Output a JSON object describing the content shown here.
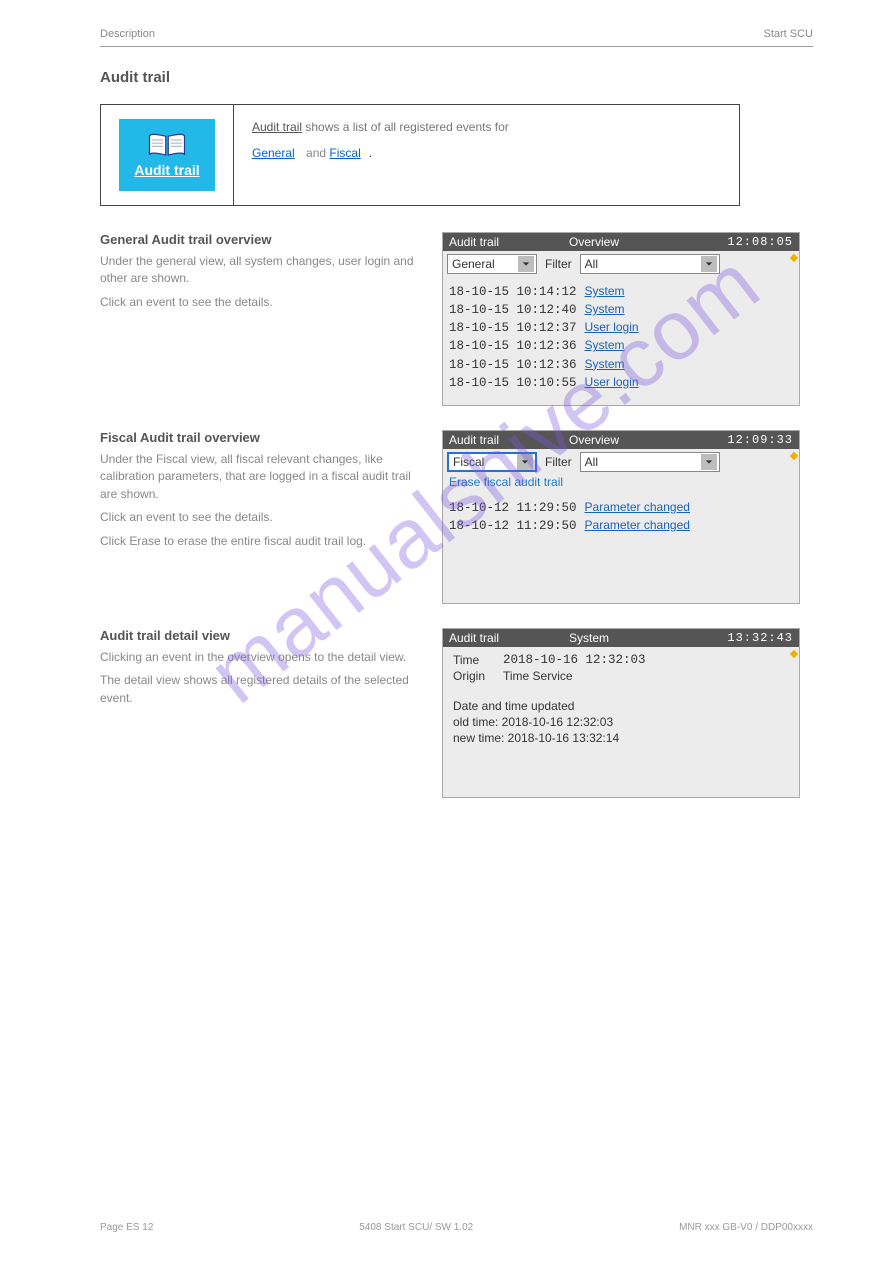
{
  "header": {
    "left": "Description",
    "right": "Start SCU"
  },
  "watermark": "manualshive.com",
  "section_title": "Audit trail",
  "icon_box": {
    "label": "Audit trail"
  },
  "desc": {
    "lead": "Audit trail",
    "text": " shows a list of all registered events for",
    "link1": "General",
    "and": "and",
    "link2": "Fiscal",
    "tail": "."
  },
  "rows": [
    {
      "id": "general",
      "heading": "General Audit trail overview",
      "paras": [
        "Under the general view, all system changes, user login and other are shown.",
        "Click an event to see the details."
      ],
      "panel": {
        "title_left": "Audit trail",
        "title_mid": "Overview",
        "title_right": "12:08:05",
        "select_value": "General",
        "filter_label": "Filter",
        "filter_value": "All",
        "logs": [
          {
            "dt": "18-10-15 10:14:12",
            "evt": "System"
          },
          {
            "dt": "18-10-15 10:12:40",
            "evt": "System"
          },
          {
            "dt": "18-10-15 10:12:37",
            "evt": "User login"
          },
          {
            "dt": "18-10-15 10:12:36",
            "evt": "System"
          },
          {
            "dt": "18-10-15 10:12:36",
            "evt": "System"
          },
          {
            "dt": "18-10-15 10:10:55",
            "evt": "User login"
          }
        ]
      }
    },
    {
      "id": "fiscal",
      "heading": "Fiscal Audit trail overview",
      "paras": [
        "Under the Fiscal view, all fiscal relevant changes, like calibration parameters, that are logged in a fiscal audit trail are shown.",
        "Click an event to see the details.",
        "Click Erase to erase the entire fiscal audit trail log."
      ],
      "panel": {
        "title_left": "Audit trail",
        "title_mid": "Overview",
        "title_right": "12:09:33",
        "select_value": "Fiscal",
        "filter_label": "Filter",
        "filter_value": "All",
        "erase_label": "Erase fiscal audit trail",
        "logs": [
          {
            "dt": "18-10-12 11:29:50",
            "evt": "Parameter changed"
          },
          {
            "dt": "18-10-12 11:29:50",
            "evt": "Parameter changed"
          }
        ]
      }
    },
    {
      "id": "detail",
      "heading": "Audit trail detail view",
      "paras": [
        "Clicking an event in the overview opens to the detail view.",
        "The detail view shows all registered details of the selected event."
      ],
      "detail_panel": {
        "title_left": "Audit trail",
        "title_mid": "System",
        "title_right": "13:32:43",
        "time_label": "Time",
        "time_value": "2018-10-16 12:32:03",
        "origin_label": "Origin",
        "origin_value": "Time Service",
        "msg1": "Date and time updated",
        "msg2": "old time: 2018-10-16 12:32:03",
        "msg3": "new time: 2018-10-16 13:32:14"
      }
    }
  ],
  "footer": {
    "left": "Page ES 12",
    "mid": "5408 Start SCU/ SW 1.02",
    "right": "MNR xxx GB-V0 / DDP00xxxx"
  }
}
